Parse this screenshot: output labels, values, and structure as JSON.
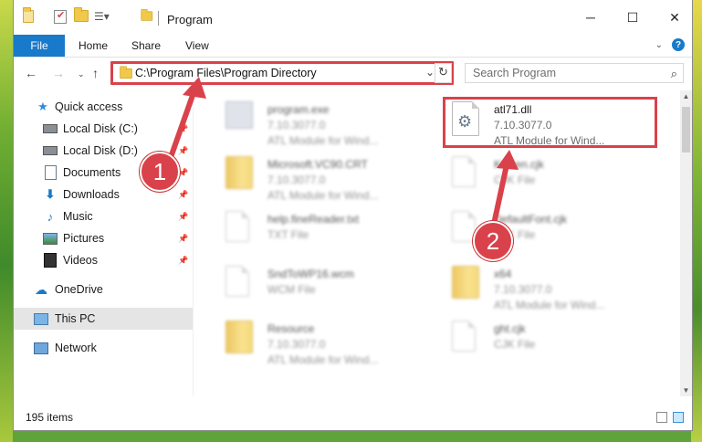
{
  "window": {
    "title": "Program"
  },
  "ribbon": {
    "file": "File",
    "home": "Home",
    "share": "Share",
    "view": "View"
  },
  "address": {
    "path": "C:\\Program Files\\Program Directory"
  },
  "search": {
    "placeholder": "Search Program"
  },
  "sidebar": {
    "items": [
      {
        "label": "Quick access",
        "icon": "star-icon"
      },
      {
        "label": "Local Disk (C:)",
        "icon": "drive-icon"
      },
      {
        "label": "Local Disk (D:)",
        "icon": "drive-icon"
      },
      {
        "label": "Documents",
        "icon": "documents-icon"
      },
      {
        "label": "Downloads",
        "icon": "download-icon"
      },
      {
        "label": "Music",
        "icon": "music-icon"
      },
      {
        "label": "Pictures",
        "icon": "pictures-icon"
      },
      {
        "label": "Videos",
        "icon": "videos-icon"
      },
      {
        "label": "OneDrive",
        "icon": "cloud-icon"
      },
      {
        "label": "This PC",
        "icon": "pc-icon"
      },
      {
        "label": "Network",
        "icon": "network-icon"
      }
    ]
  },
  "files": [
    {
      "name": "program.exe",
      "version": "7.10.3077.0",
      "desc": "ATL Module for Wind..."
    },
    {
      "name": "atl71.dll",
      "version": "7.10.3077.0",
      "desc": "ATL Module for Wind..."
    },
    {
      "name": "Microsoft.VC90.CRT",
      "version": "7.10.3077.0",
      "desc": "ATL Module for Wind..."
    },
    {
      "name": "Kaizen.cjk",
      "version": "",
      "desc": "CJK File"
    },
    {
      "name": "help.fineReader.txt",
      "version": "",
      "desc": "TXT File"
    },
    {
      "name": "DefaultFont.cjk",
      "version": "",
      "desc": "CJK File"
    },
    {
      "name": "SndToWP16.wcm",
      "version": "",
      "desc": "WCM File"
    },
    {
      "name": "x64",
      "version": "7.10.3077.0",
      "desc": "ATL Module for Wind..."
    },
    {
      "name": "Resource",
      "version": "7.10.3077.0",
      "desc": "ATL Module for Wind..."
    },
    {
      "name": "ght.cjk",
      "version": "",
      "desc": "CJK File"
    }
  ],
  "status": {
    "items": "195 items"
  },
  "annotations": {
    "one": "1",
    "two": "2"
  },
  "colors": {
    "accent": "#1979ca",
    "highlight": "#d9424b"
  }
}
